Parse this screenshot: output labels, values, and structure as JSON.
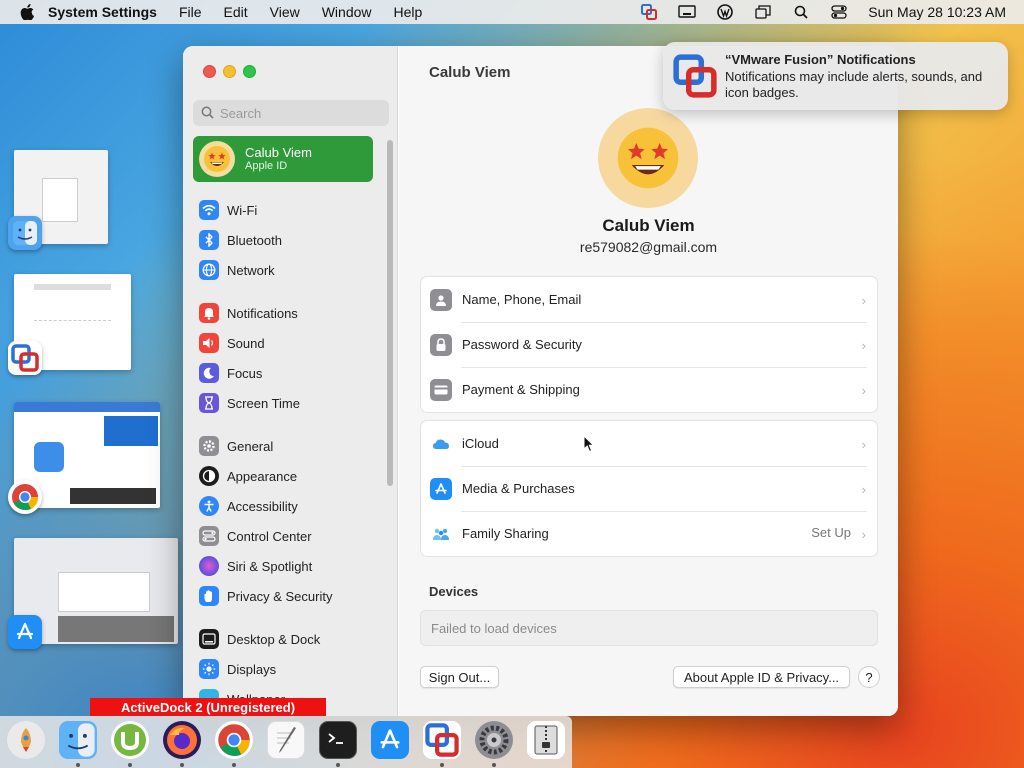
{
  "menubar": {
    "app_name": "System Settings",
    "items": [
      "File",
      "Edit",
      "View",
      "Window",
      "Help"
    ],
    "clock": "Sun May 28  10:23 AM"
  },
  "window": {
    "search_placeholder": "Search",
    "apple_id_card": {
      "name": "Calub Viem",
      "subtitle": "Apple ID"
    },
    "sidebar": {
      "items": [
        {
          "label": "Wi-Fi",
          "icon": "wifi-icon",
          "color": "#2f86f6"
        },
        {
          "label": "Bluetooth",
          "icon": "bluetooth-icon",
          "color": "#2f86f6"
        },
        {
          "label": "Network",
          "icon": "globe-icon",
          "color": "#2f86f6"
        },
        {
          "label": "Notifications",
          "icon": "bell-icon",
          "color": "#f0453a"
        },
        {
          "label": "Sound",
          "icon": "speaker-icon",
          "color": "#f0453a"
        },
        {
          "label": "Focus",
          "icon": "moon-icon",
          "color": "#5a5ce0"
        },
        {
          "label": "Screen Time",
          "icon": "hourglass-icon",
          "color": "#6a55d8"
        },
        {
          "label": "General",
          "icon": "gear-icon",
          "color": "#8e8e93"
        },
        {
          "label": "Appearance",
          "icon": "appearance-icon",
          "color": "#1c1c1e"
        },
        {
          "label": "Accessibility",
          "icon": "accessibility-icon",
          "color": "#2f86f6"
        },
        {
          "label": "Control Center",
          "icon": "control-center-icon",
          "color": "#8e8e93"
        },
        {
          "label": "Siri & Spotlight",
          "icon": "siri-icon",
          "color": "#b34ad6"
        },
        {
          "label": "Privacy & Security",
          "icon": "hand-icon",
          "color": "#2f86f6"
        },
        {
          "label": "Desktop & Dock",
          "icon": "dock-icon",
          "color": "#1c1c1e"
        },
        {
          "label": "Displays",
          "icon": "sun-icon",
          "color": "#2f86f6"
        },
        {
          "label": "Wallpaper",
          "icon": "wallpaper-icon",
          "color": "#2fb5e8"
        }
      ]
    },
    "main": {
      "title": "Calub Viem",
      "profile": {
        "name": "Calub Viem",
        "email": "re579082@gmail.com"
      },
      "group1": [
        {
          "label": "Name, Phone, Email",
          "icon": "person-icon",
          "color": "#8e8e93"
        },
        {
          "label": "Password & Security",
          "icon": "lock-icon",
          "color": "#8e8e93"
        },
        {
          "label": "Payment & Shipping",
          "icon": "credit-card-icon",
          "color": "#8e8e93"
        }
      ],
      "group2": [
        {
          "label": "iCloud",
          "icon": "cloud-icon",
          "color": "#3a9cf2",
          "value": ""
        },
        {
          "label": "Media & Purchases",
          "icon": "app-store-icon",
          "color": "#1f8ef5",
          "value": ""
        },
        {
          "label": "Family Sharing",
          "icon": "family-icon",
          "color": "#5fb9f0",
          "value": "Set Up"
        }
      ],
      "devices_heading": "Devices",
      "devices_message": "Failed to load devices",
      "sign_out": "Sign Out...",
      "about": "About Apple ID & Privacy...",
      "help": "?"
    }
  },
  "notification": {
    "title": "“VMware Fusion” Notifications",
    "body": "Notifications may include alerts, sounds, and icon badges."
  },
  "activedock_banner": "ActiveDock 2 (Unregistered)",
  "dock": {
    "apps": [
      "launchpad-icon",
      "finder-icon",
      "utorrent-icon",
      "firefox-icon",
      "chrome-icon",
      "textedit-icon",
      "terminal-icon",
      "app-store-icon",
      "vmware-fusion-icon",
      "system-settings-icon",
      "archive-icon"
    ]
  }
}
